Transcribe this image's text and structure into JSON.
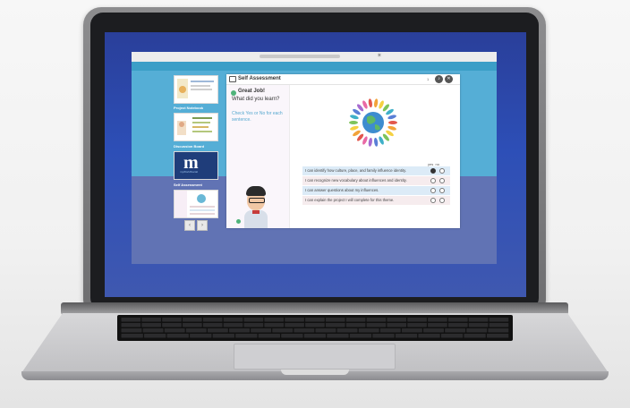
{
  "browser": {
    "icon": "globe-icon"
  },
  "sidebar": {
    "items": [
      {
        "label": "",
        "thumb": "cover-page"
      },
      {
        "label": "Project Notebook",
        "thumb": "notebook-page"
      },
      {
        "label": "Discussion Board",
        "thumb": "discussion-page"
      },
      {
        "label": "Self Assessment",
        "thumb": "self-assessment-page"
      }
    ],
    "discussion_logo_letter": "m",
    "discussion_logo_sub": "myWorldSocial",
    "prev_icon": "chevron-left-icon",
    "next_icon": "chevron-right-icon"
  },
  "panel": {
    "title": "Self Assessment",
    "page_count": "1",
    "great_job": "Great Job!",
    "question": "What did you learn?",
    "instruction": "Check Yes or No for each sentence.",
    "audio_icon": "speaker-icon",
    "close_icon": "close-icon"
  },
  "assessment": {
    "columns": {
      "yes": "yes",
      "no": "no"
    },
    "statements": [
      {
        "text": "I can identify how culture, place, and family influence identity.",
        "selected": "yes"
      },
      {
        "text": "I can recognize new vocabulary about influences and identity.",
        "selected": null
      },
      {
        "text": "I can answer questions about my influences.",
        "selected": null
      },
      {
        "text": "I can explain the project I will complete for this theme.",
        "selected": null
      }
    ]
  },
  "colors": {
    "app_accent": "#55aed6",
    "header_bar": "#3b9ec7",
    "background_band": "#6173b4",
    "success_green": "#4fb37a",
    "instruction_blue": "#56a8cf"
  }
}
